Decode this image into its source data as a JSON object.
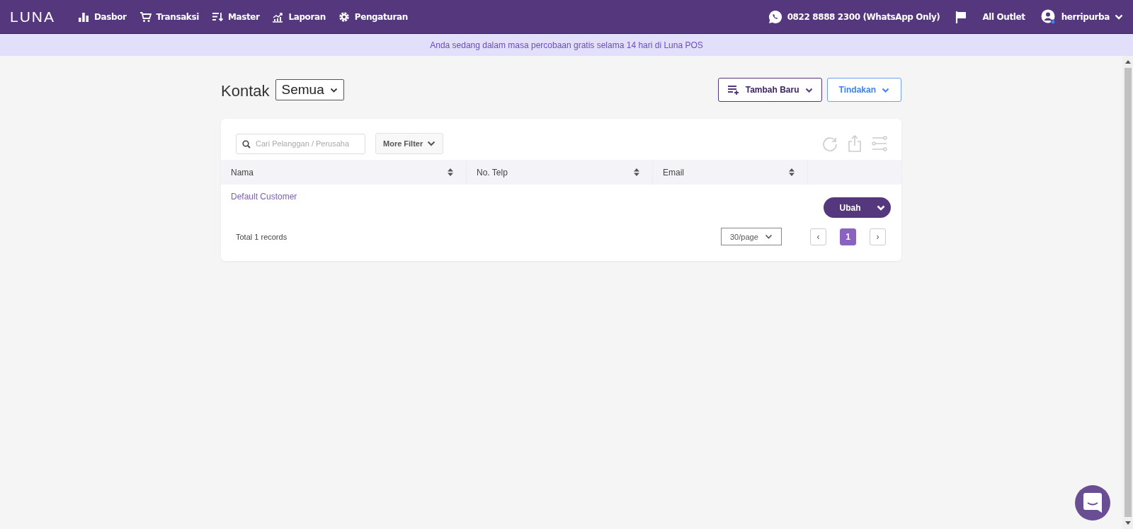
{
  "nav": {
    "logo": "LUNA",
    "items": [
      {
        "label": "Dasbor",
        "kind": "bars"
      },
      {
        "label": "Transaksi",
        "kind": "cart"
      },
      {
        "label": "Master",
        "kind": "sort"
      },
      {
        "label": "Laporan",
        "kind": "growth"
      },
      {
        "label": "Pengaturan",
        "kind": "gear"
      }
    ],
    "phone": "0822 8888 2300 (WhatsApp Only)",
    "outlet": "All Outlet",
    "user": "herripurba"
  },
  "banner": "Anda sedang dalam masa percobaan gratis selama 14 hari di Luna POS",
  "page": {
    "title": "Kontak",
    "filter": "Semua",
    "add_button": "Tambah Baru",
    "action_button": "Tindakan"
  },
  "search": {
    "placeholder": "Cari Pelanggan / Perusaha"
  },
  "more_filter": "More Filter",
  "table": {
    "columns": [
      "Nama",
      "No. Telp",
      "Email"
    ],
    "rows": [
      {
        "name": "Default Customer",
        "action": "Ubah"
      }
    ]
  },
  "footer": {
    "total": "Total 1 records",
    "page_size": "30/page",
    "prev": "‹",
    "next": "›",
    "pages": [
      {
        "label": "1",
        "selected": true
      }
    ]
  }
}
